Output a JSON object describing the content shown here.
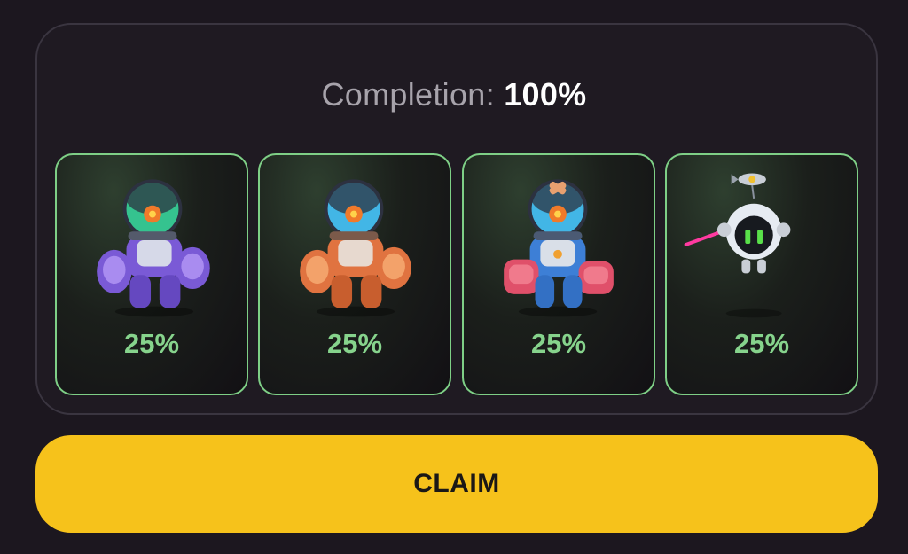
{
  "completion": {
    "label": "Completion: ",
    "value": "100%",
    "fraction": 1.0
  },
  "cards": [
    {
      "name": "purple-robot",
      "percent": "25%",
      "colors": {
        "body": "#7a5ad6",
        "accent": "#a98cf0",
        "dome": "#35c38f"
      }
    },
    {
      "name": "orange-robot",
      "percent": "25%",
      "colors": {
        "body": "#e07340",
        "accent": "#f3a26a",
        "dome": "#42b6e6"
      }
    },
    {
      "name": "blue-red-robot",
      "percent": "25%",
      "colors": {
        "body": "#3d7fd6",
        "accent": "#e0506a",
        "dome": "#42b6e6"
      }
    },
    {
      "name": "drone-robot",
      "percent": "25%",
      "colors": {
        "body": "#e6ebf2",
        "accent": "#ff3aa0",
        "dome": "#59e04a"
      }
    }
  ],
  "claim_button": {
    "label": "CLAIM"
  },
  "theme": {
    "background": "#1c171f",
    "card_border": "#7ecf86",
    "percent_color": "#86d38c",
    "button_color": "#f6c21b"
  }
}
